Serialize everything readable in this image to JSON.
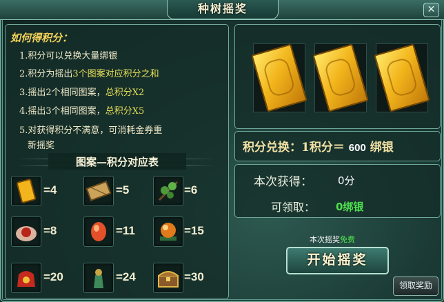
{
  "window": {
    "title": "种树摇奖",
    "close_symbol": "✕"
  },
  "rules": {
    "heading": "如何得积分：",
    "items": [
      {
        "prefix": "1.积分可以兑换大量绑银",
        "highlight": "",
        "suffix": ""
      },
      {
        "prefix": "2.积分为摇出",
        "highlight": "3个图案对应积分之和",
        "suffix": ""
      },
      {
        "prefix": "3.摇出2个相同图案，",
        "highlight": "总积分X2",
        "suffix": ""
      },
      {
        "prefix": "4.摇出3个相同图案，",
        "highlight": "总积分X5",
        "suffix": ""
      },
      {
        "prefix": "5.对获得积分不满意，可消耗金券重",
        "highlight": "",
        "suffix": ""
      },
      {
        "prefix": "新摇奖",
        "highlight": "",
        "suffix": ""
      }
    ]
  },
  "table": {
    "title": "图案—积分对应表",
    "entries": [
      {
        "icon": "gold-card-icon",
        "value": "=4"
      },
      {
        "icon": "bamboo-scroll-icon",
        "value": "=5"
      },
      {
        "icon": "herb-branch-icon",
        "value": "=6"
      },
      {
        "icon": "red-pouch-icon",
        "value": "=8"
      },
      {
        "icon": "red-gem-icon",
        "value": "=11"
      },
      {
        "icon": "orange-orb-icon",
        "value": "=15"
      },
      {
        "icon": "lucky-bag-icon",
        "value": "=20"
      },
      {
        "icon": "jade-statue-icon",
        "value": "=24"
      },
      {
        "icon": "treasure-chest-icon",
        "value": "=30"
      }
    ]
  },
  "slots": [
    {
      "icon": "gold-card-icon"
    },
    {
      "icon": "gold-card-icon"
    },
    {
      "icon": "gold-card-icon"
    }
  ],
  "exchange": {
    "label": "积分兑换：1积分＝",
    "amount": "600",
    "unit": "绑银"
  },
  "result": {
    "got_label": "本次获得：",
    "got_value": "0分",
    "claim_label": "可领取：",
    "claim_value": "0绑银"
  },
  "note": {
    "prefix": "本次摇奖",
    "free": "免费"
  },
  "buttons": {
    "start": "开始摇奖",
    "claim": "领取奖励"
  }
}
